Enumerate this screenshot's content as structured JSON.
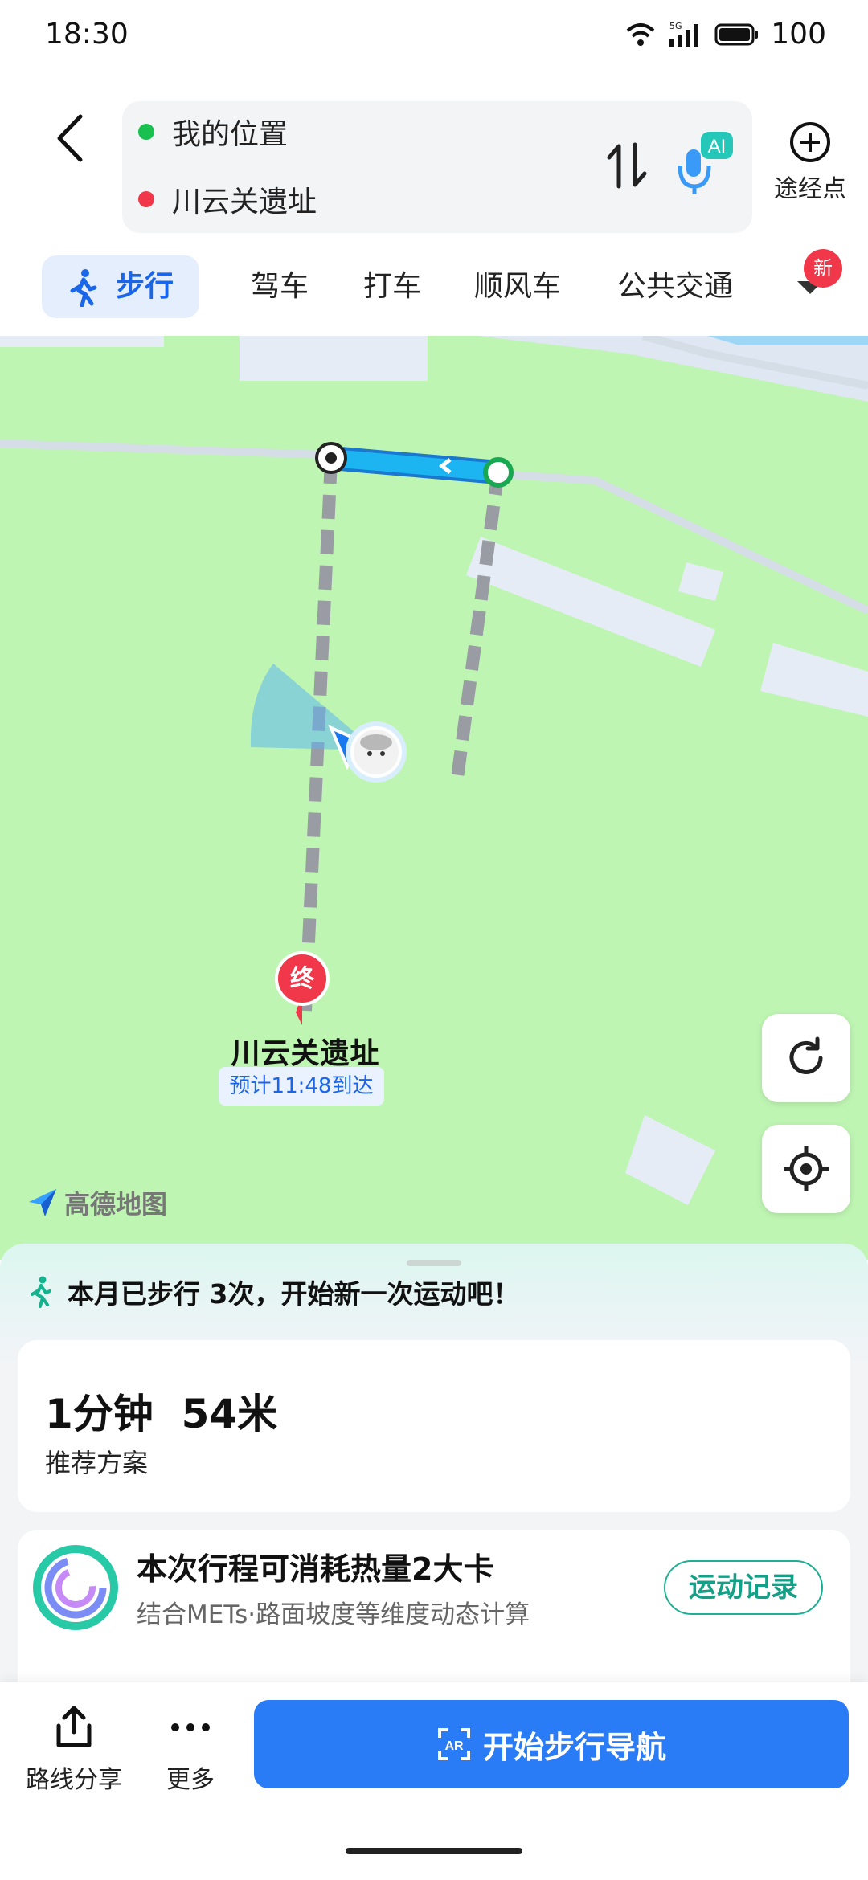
{
  "status_bar": {
    "time": "18:30",
    "network": "5G",
    "battery": "100"
  },
  "route": {
    "from": "我的位置",
    "to": "川云关遗址",
    "from_color": "#18c04f",
    "to_color": "#f0384a",
    "mic_badge": "AI",
    "waypoint_label": "途经点"
  },
  "tabs": [
    {
      "label": "步行",
      "active": true
    },
    {
      "label": "驾车"
    },
    {
      "label": "打车"
    },
    {
      "label": "顺风车"
    },
    {
      "label": "公共交通"
    }
  ],
  "new_badge": "新",
  "map": {
    "end_marker": "终",
    "destination": "川云关遗址",
    "eta": "预计11:48到达",
    "logo": "高德地图"
  },
  "sheet": {
    "tip": "本月已步行 3次，开始新一次运动吧！",
    "route_summary": "1分钟  54米",
    "route_type": "推荐方案",
    "calorie_title": "本次行程可消耗热量2大卡",
    "calorie_sub": "结合METs·路面坡度等维度动态计算",
    "record_button": "运动记录"
  },
  "actions": {
    "share": "路线分享",
    "more": "更多",
    "start_nav": "开始步行导航"
  },
  "colors": {
    "accent": "#2a7cf6",
    "map_green": "#bff5b3",
    "route_blue": "#1db4f2"
  }
}
